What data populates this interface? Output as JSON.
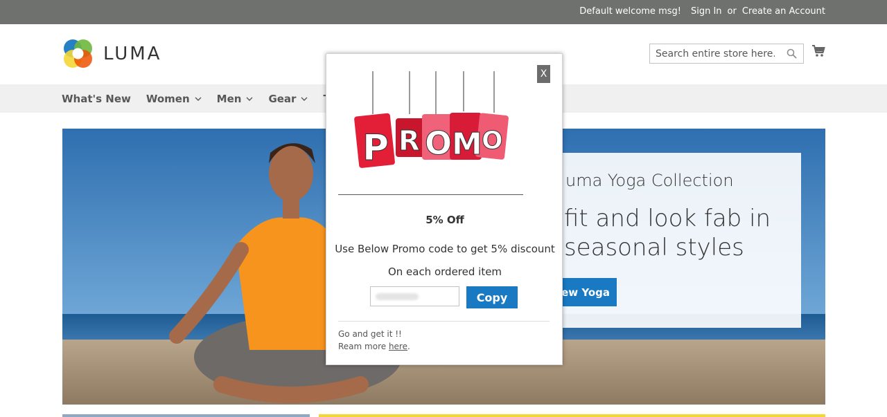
{
  "topbar": {
    "welcome": "Default welcome msg!",
    "sign_in": "Sign In",
    "or": "or",
    "create_account": "Create an Account"
  },
  "header": {
    "logo_text": "LUMA",
    "search_placeholder": "Search entire store here...",
    "icons": [
      "search-icon",
      "cart-icon"
    ]
  },
  "nav": {
    "items": [
      {
        "label": "What's New",
        "dropdown": false
      },
      {
        "label": "Women",
        "dropdown": true
      },
      {
        "label": "Men",
        "dropdown": true
      },
      {
        "label": "Gear",
        "dropdown": true
      },
      {
        "label": "Tr",
        "dropdown": false
      }
    ]
  },
  "hero": {
    "subtitle": "uma Yoga Collection",
    "headline_line1": "fit and look fab in",
    "headline_line2": "seasonal styles",
    "button_label": "ew Yoga"
  },
  "popup": {
    "close_label": "X",
    "promo_word": "PROMO",
    "discount_title": "5% Off",
    "description_line1": "Use Below Promo code to get 5% discount",
    "description_line2": "On each ordered item",
    "copy_label": "Copy",
    "footer_line1": "Go and get it !!",
    "footer_line2_prefix": "Ream more ",
    "footer_link": "here",
    "footer_line2_suffix": "."
  },
  "colors": {
    "topbar_bg": "#6e716e",
    "nav_bg": "#f0f0f0",
    "primary_button": "#1979c3",
    "promo_red": "#e31e37"
  }
}
